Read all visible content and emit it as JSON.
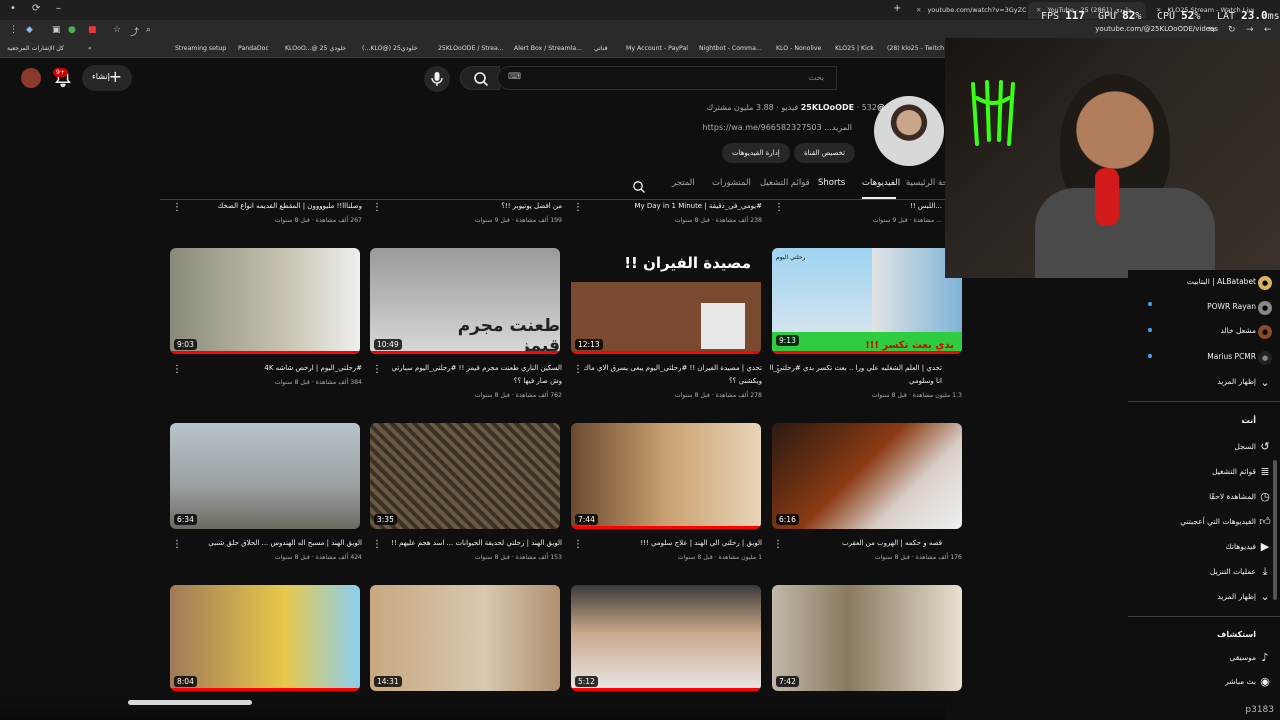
{
  "browser": {
    "tabs": [
      {
        "label": "youtube.com/watch?v=3GyZO..."
      },
      {
        "label": "YouTube - 25 خلودي (2861)"
      },
      {
        "label": "KLO25 Stream - Watch Live on"
      }
    ],
    "url": "youtube.com/@25KLOoODE/videos"
  },
  "perf": {
    "fps_label": "FPS",
    "fps": "117",
    "gpu_label": "GPU",
    "gpu": "82",
    "cpu_label": "CPU",
    "cpu": "52",
    "lat_label": "LAT",
    "lat": "23.0",
    "gpu_unit": "%",
    "cpu_unit": "%",
    "lat_unit": "ms"
  },
  "bookmarks": {
    "all": "كل الإشارات المرجعية",
    "items": [
      "Streaming setup",
      "PandaDoc",
      "KLOoO...@ 25 خلودي",
      "(...KLO@) خلودي25",
      "25KLOoODE / Strea...",
      "Alert Box / Streamla...",
      "قناتي",
      "My Account - PayPal",
      "Nightbot - Comma...",
      "KLO - Nonolive",
      "KLO25 | Kick",
      "(28) klo25 - Twitch"
    ]
  },
  "header": {
    "create_label": "إنشاء",
    "notif_count": "9+",
    "search_placeholder": "بحث"
  },
  "channel": {
    "handle": "@25KLOoODE",
    "stats": "532 فيديو · 3.88 مليون مشترك",
    "link": "https://wa.me/966582327503",
    "more": "...المزيد",
    "customize": "تخصيص القناة",
    "manage": "إدارة الفيديوهات"
  },
  "tabs": [
    {
      "label": "الصفحة الرئيسية"
    },
    {
      "label": "الفيديوهات"
    },
    {
      "label": "Shorts"
    },
    {
      "label": "قوائم التشغيل"
    },
    {
      "label": "المنشورات"
    },
    {
      "label": "المتجر"
    }
  ],
  "top_row": [
    {
      "title": "...اللبس !!",
      "meta": "... مشاهدة · قبل 9 سنوات"
    },
    {
      "title": "#يومي_في_دقيقة | My Day in 1 Minute",
      "meta": "238 ألف مشاهدة · قبل 8 سنوات"
    },
    {
      "title": "من افضل يوتيوبر !!؟",
      "meta": "199 ألف مشاهدة · قبل 9 سنوات"
    },
    {
      "title": "وصلنااا!! مليوووون | المقطع القديمه انواع الصحك",
      "meta": "267 ألف مشاهدة · قبل 8 سنوات"
    }
  ],
  "row1": [
    {
      "duration": "9:13",
      "title": "تحدي | العلم الشغليه علي ورا .. بعث تكسر بدي #رحلتي_اليوم",
      "title2": "انا وسلومي",
      "meta": "1.3 مليون مشاهدة · قبل 8 سنوات",
      "overlay": "بدي بعث تكسر !!!",
      "overlay_top": "رحلتي اليوم",
      "progress": 1.0
    },
    {
      "duration": "12:13",
      "title": "تحدي | مصيدة الفيران !! #رحلتي_اليوم يبغى يسرق الاي ماك",
      "title2": "ويكشني ؟؟",
      "meta": "278 ألف مشاهدة · قبل 8 سنوات",
      "overlay": "مصيدة الفيران !!",
      "progress": 1.0
    },
    {
      "duration": "10:49",
      "title": "السكين الناري طعنت مجرم قيمز !! #رحلتي_اليوم سيارتي",
      "title2": "وش صار فيها ؟؟",
      "meta": "762 ألف مشاهدة · قبل 8 سنوات",
      "overlay": "طعنت مجرم قيمز",
      "progress": 1.0
    },
    {
      "duration": "9:03",
      "title": "#رحلتي_اليوم | ارخص شاشه 4K",
      "title2": "",
      "meta": "384 ألف مشاهدة · قبل 8 سنوات",
      "overlay": "",
      "progress": 1.0
    }
  ],
  "row2": [
    {
      "duration": "6:16",
      "title": "قصه و حكمه | الهروب من العقرب",
      "meta": "176 ألف مشاهدة · قبل 8 سنوات",
      "progress": 0.0
    },
    {
      "duration": "7:44",
      "title": "الوبق | رحلتي الى الهند | علاج سلومي !!!",
      "meta": "1 مليون مشاهدة · قبل 8 سنوات",
      "progress": 1.0
    },
    {
      "duration": "3:35",
      "title": "الوبق الهند | رحلتي لحديقة الحيوانات ... اسد هجم عليهم !!",
      "meta": "153 ألف مشاهدة · قبل 8 سنوات",
      "progress": 0.0
    },
    {
      "duration": "6:34",
      "title": "الوبق الهند | مسبح اله الهندوس ... الحلاق حلق شنبي",
      "meta": "424 ألف مشاهدة · قبل 8 سنوات",
      "progress": 0.0
    }
  ],
  "row3": [
    {
      "duration": "7:42",
      "progress": 0.0
    },
    {
      "duration": "5:12",
      "progress": 1.0
    },
    {
      "duration": "14:31",
      "progress": 0.0
    },
    {
      "duration": "8:04",
      "progress": 1.0
    }
  ],
  "sidebar": {
    "subs": [
      {
        "label": "ALBatabet | البتابيت"
      },
      {
        "label": "POWR Rayan"
      },
      {
        "label": "مشعل خالد"
      },
      {
        "label": "Marius PCMR"
      }
    ],
    "show_more": "إظهار المزيد",
    "you_header": "أنت",
    "you_items": [
      {
        "label": "السجل",
        "icon": "history-icon"
      },
      {
        "label": "قوائم التشغيل",
        "icon": "playlists-icon"
      },
      {
        "label": "المشاهدة لاحقًا",
        "icon": "watch-later-icon"
      },
      {
        "label": "الفيديوهات التي أعجبتني",
        "icon": "like-icon"
      },
      {
        "label": "فيديوهاتك",
        "icon": "your-videos-icon"
      },
      {
        "label": "عمليات التنزيل",
        "icon": "download-icon"
      }
    ],
    "show_more2": "إظهار المزيد",
    "explore_header": "استكشاف",
    "explore_items": [
      {
        "label": "موسيقى",
        "icon": "music-icon"
      },
      {
        "label": "بث مباشر",
        "icon": "live-icon"
      }
    ]
  },
  "frame_counter": "p3183",
  "colors": {
    "accent": "#ff0000",
    "bg": "#0f0f0f",
    "link": "#3ea6ff"
  }
}
